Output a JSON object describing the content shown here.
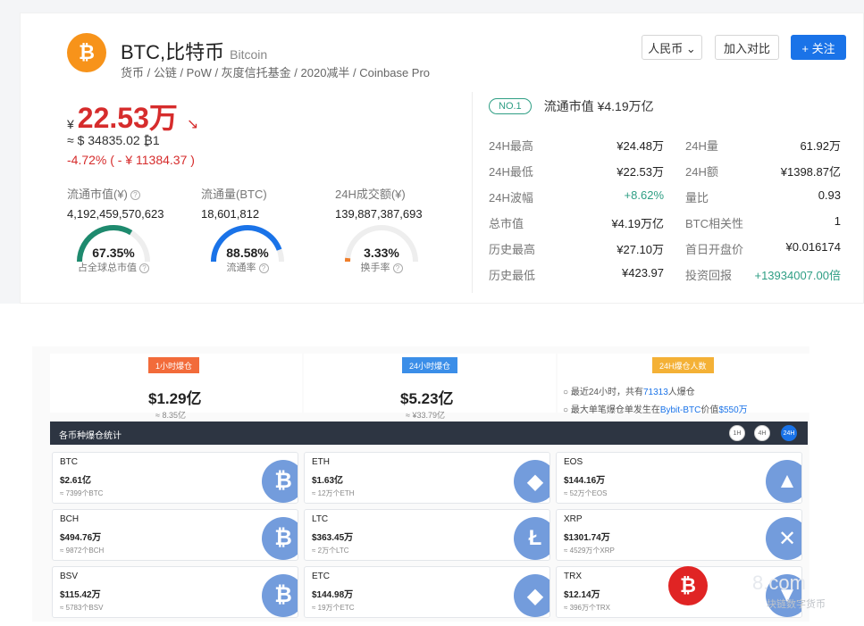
{
  "coin": {
    "symbol_name": "BTC,比特币",
    "english": "Bitcoin",
    "logo_glyph": "₿",
    "tags": "货币 / 公链 / PoW / 灰度信托基金 / 2020减半 / Coinbase Pro"
  },
  "actions": {
    "currency": "人民币 ⌄",
    "compare": "加入对比",
    "follow": "+ 关注"
  },
  "price": {
    "currency_symbol": "¥",
    "value": "22.53万",
    "trend_icon": "↘",
    "usd": "≈ $ 34835.02  ₿1",
    "change": "-4.72% ( - ¥ 11384.37 )"
  },
  "stats": {
    "market_cap_label": "流通市值(¥)",
    "market_cap": "4,192,459,570,623",
    "supply_label": "流通量(BTC)",
    "supply": "18,601,812",
    "volume_label": "24H成交额(¥)",
    "volume": "139,887,387,693"
  },
  "gauges": [
    {
      "pct": "67.35%",
      "label": "占全球总市值",
      "value": 67.35,
      "color": "#1e8a6e"
    },
    {
      "pct": "88.58%",
      "label": "流通率",
      "value": 88.58,
      "color": "#1a73e8"
    },
    {
      "pct": "3.33%",
      "label": "换手率",
      "value": 3.33,
      "color": "#f07e2a"
    }
  ],
  "rank": {
    "badge": "NO.1",
    "market_cap_text": "流通市值  ¥4.19万亿"
  },
  "details": [
    {
      "k": "24H最高",
      "v": "¥24.48万",
      "k2": "24H量",
      "v2": "61.92万"
    },
    {
      "k": "24H最低",
      "v": "¥22.53万",
      "k2": "24H额",
      "v2": "¥1398.87亿"
    },
    {
      "k": "24H波幅",
      "v": "+8.62%",
      "k2": "量比",
      "v2": "0.93"
    },
    {
      "k": "总市值",
      "v": "¥4.19万亿",
      "k2": "BTC相关性",
      "v2": "1"
    },
    {
      "k": "历史最高",
      "v": "¥27.10万",
      "k2": "首日开盘价",
      "v2": "¥0.016174"
    },
    {
      "k": "历史最低",
      "v": "¥423.97",
      "k2": "投资回报",
      "v2": "+13934007.00倍"
    }
  ],
  "liquidation": {
    "h1_tag": "1小时爆仓",
    "h1_value": "$1.29亿",
    "h1_cny": "≈ 8.35亿",
    "h24_tag": "24小时爆仓",
    "h24_value": "$5.23亿",
    "h24_cny": "≈ ¥33.79亿",
    "people_tag": "24H爆仓人数",
    "info1_pre": "最近24小时，共有",
    "info1_num": "71313",
    "info1_post": "人爆仓",
    "info2_pre": "最大单笔爆仓单发生在",
    "info2_hl": "Bybit-BTC",
    "info2_mid": "价值",
    "info2_val": "$550万",
    "bar_title": "各币种爆仓统计",
    "tf": [
      "1H",
      "4H",
      "24H"
    ]
  },
  "coins": [
    {
      "n": "BTC",
      "a": "$2.61亿",
      "s": "≈ 7399个BTC",
      "g": "₿"
    },
    {
      "n": "ETH",
      "a": "$1.63亿",
      "s": "≈ 12万个ETH",
      "g": "◆"
    },
    {
      "n": "EOS",
      "a": "$144.16万",
      "s": "≈ 52万个EOS",
      "g": "▲"
    },
    {
      "n": "BCH",
      "a": "$494.76万",
      "s": "≈ 9872个BCH",
      "g": "₿"
    },
    {
      "n": "LTC",
      "a": "$363.45万",
      "s": "≈ 2万个LTC",
      "g": "Ł"
    },
    {
      "n": "XRP",
      "a": "$1301.74万",
      "s": "≈ 4529万个XRP",
      "g": "✕"
    },
    {
      "n": "BSV",
      "a": "$115.42万",
      "s": "≈ 5783个BSV",
      "g": "₿"
    },
    {
      "n": "ETC",
      "a": "$144.98万",
      "s": "≈ 19万个ETC",
      "g": "◆"
    },
    {
      "n": "TRX",
      "a": "$12.14万",
      "s": "≈ 396万个TRX",
      "g": "▼"
    }
  ],
  "watermark": {
    "glyph": "₿",
    "text": "8.com",
    "sub": "块链数字货币"
  }
}
